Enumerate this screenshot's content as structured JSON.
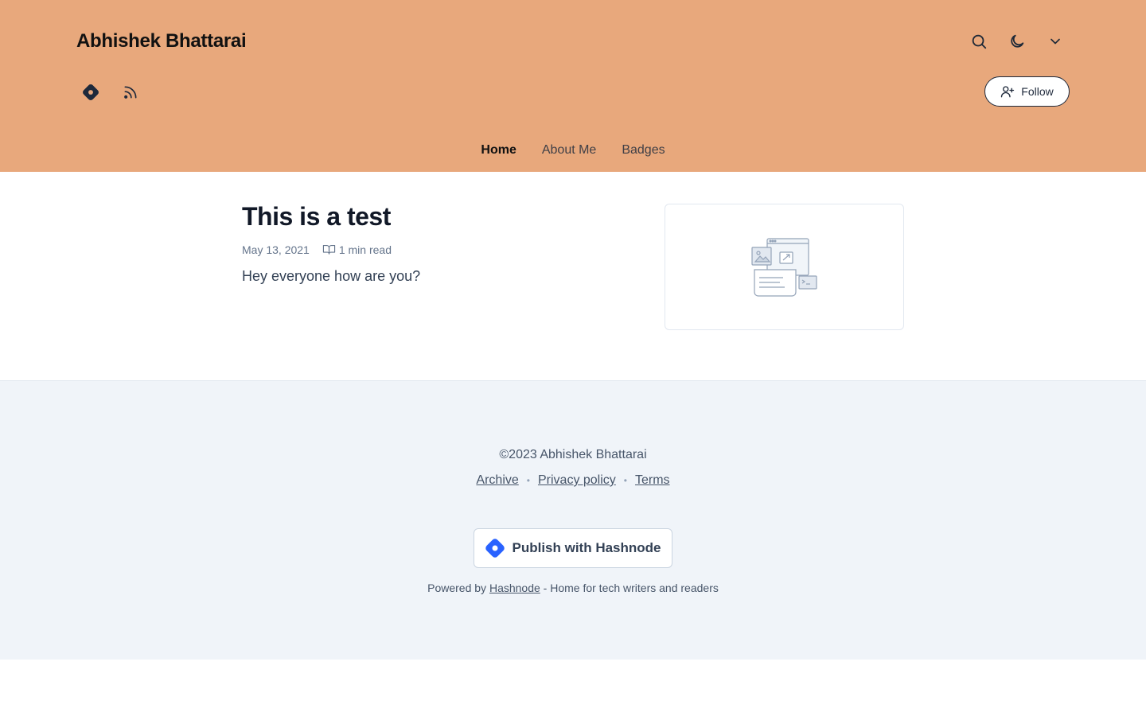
{
  "header": {
    "site_title": "Abhishek Bhattarai",
    "background_color": "#e8a87c",
    "icons": {
      "search": "search-icon",
      "theme": "moon-icon",
      "menu": "chevron-down-icon",
      "hashnode": "hashnode-logo-icon",
      "rss": "rss-icon",
      "follow": "user-plus-icon"
    },
    "follow_label": "Follow",
    "nav": [
      {
        "label": "Home",
        "active": true
      },
      {
        "label": "About Me",
        "active": false
      },
      {
        "label": "Badges",
        "active": false
      }
    ]
  },
  "post": {
    "title": "This is a test",
    "date": "May 13, 2021",
    "read_time": "1 min read",
    "excerpt": "Hey everyone how are you?",
    "thumbnail_icon": "placeholder-illustration-icon"
  },
  "footer": {
    "copyright": "©2023 Abhishek Bhattarai",
    "links": [
      "Archive",
      "Privacy policy",
      "Terms"
    ],
    "publish_label": "Publish with Hashnode",
    "powered_prefix": "Powered by",
    "powered_link": "Hashnode",
    "powered_suffix": "- Home for tech writers and readers",
    "accent_color": "#2962ff"
  }
}
